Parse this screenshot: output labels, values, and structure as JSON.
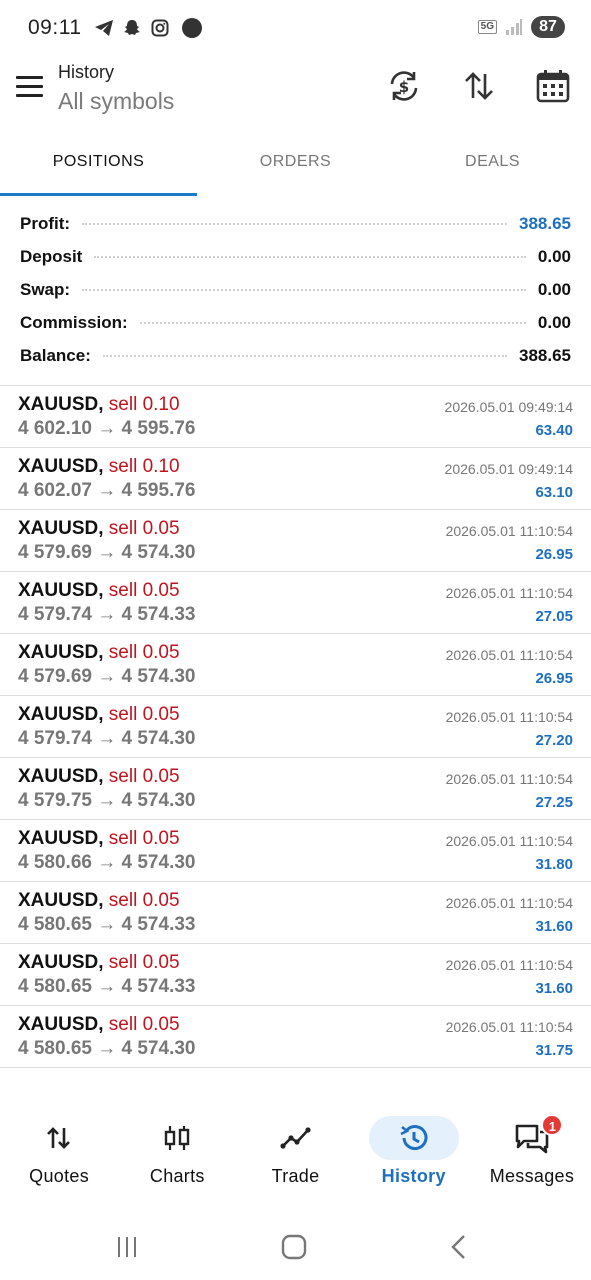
{
  "status_bar": {
    "time": "09:11",
    "network": "5G",
    "battery": "87"
  },
  "header": {
    "title": "History",
    "subtitle": "All symbols"
  },
  "tabs": [
    {
      "label": "POSITIONS",
      "active": true
    },
    {
      "label": "ORDERS",
      "active": false
    },
    {
      "label": "DEALS",
      "active": false
    }
  ],
  "summary": {
    "profit_label": "Profit:",
    "profit_value": "388.65",
    "deposit_label": "Deposit",
    "deposit_value": "0.00",
    "swap_label": "Swap:",
    "swap_value": "0.00",
    "commission_label": "Commission:",
    "commission_value": "0.00",
    "balance_label": "Balance:",
    "balance_value": "388.65"
  },
  "deals": [
    {
      "symbol": "XAUUSD,",
      "type": "sell 0.10",
      "prices": "4 602.10 → 4 595.76",
      "time": "2026.05.01 09:49:14",
      "profit": "63.40"
    },
    {
      "symbol": "XAUUSD,",
      "type": "sell 0.10",
      "prices": "4 602.07 → 4 595.76",
      "time": "2026.05.01 09:49:14",
      "profit": "63.10"
    },
    {
      "symbol": "XAUUSD,",
      "type": "sell 0.05",
      "prices": "4 579.69 → 4 574.30",
      "time": "2026.05.01 11:10:54",
      "profit": "26.95"
    },
    {
      "symbol": "XAUUSD,",
      "type": "sell 0.05",
      "prices": "4 579.74 → 4 574.33",
      "time": "2026.05.01 11:10:54",
      "profit": "27.05"
    },
    {
      "symbol": "XAUUSD,",
      "type": "sell 0.05",
      "prices": "4 579.69 → 4 574.30",
      "time": "2026.05.01 11:10:54",
      "profit": "26.95"
    },
    {
      "symbol": "XAUUSD,",
      "type": "sell 0.05",
      "prices": "4 579.74 → 4 574.30",
      "time": "2026.05.01 11:10:54",
      "profit": "27.20"
    },
    {
      "symbol": "XAUUSD,",
      "type": "sell 0.05",
      "prices": "4 579.75 → 4 574.30",
      "time": "2026.05.01 11:10:54",
      "profit": "27.25"
    },
    {
      "symbol": "XAUUSD,",
      "type": "sell 0.05",
      "prices": "4 580.66 → 4 574.30",
      "time": "2026.05.01 11:10:54",
      "profit": "31.80"
    },
    {
      "symbol": "XAUUSD,",
      "type": "sell 0.05",
      "prices": "4 580.65 → 4 574.33",
      "time": "2026.05.01 11:10:54",
      "profit": "31.60"
    },
    {
      "symbol": "XAUUSD,",
      "type": "sell 0.05",
      "prices": "4 580.65 → 4 574.33",
      "time": "2026.05.01 11:10:54",
      "profit": "31.60"
    },
    {
      "symbol": "XAUUSD,",
      "type": "sell 0.05",
      "prices": "4 580.65 → 4 574.30",
      "time": "2026.05.01 11:10:54",
      "profit": "31.75"
    }
  ],
  "bottom_nav": [
    {
      "label": "Quotes",
      "icon": "quotes-icon"
    },
    {
      "label": "Charts",
      "icon": "charts-icon"
    },
    {
      "label": "Trade",
      "icon": "trade-icon"
    },
    {
      "label": "History",
      "icon": "history-icon",
      "active": true
    },
    {
      "label": "Messages",
      "icon": "messages-icon",
      "badge": "1"
    }
  ],
  "colors": {
    "accent": "#1f78c9",
    "profit": "#1f6fc0",
    "sell": "#c0141e",
    "badge": "#e53935"
  }
}
